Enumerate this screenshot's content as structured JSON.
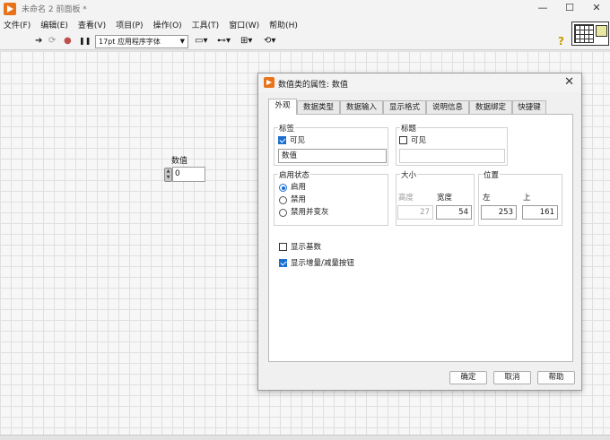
{
  "window": {
    "title": "未命名 2 前面板 *",
    "controls": [
      "—",
      "☐",
      "✕"
    ]
  },
  "menu": [
    "文件(F)",
    "编辑(E)",
    "查看(V)",
    "项目(P)",
    "操作(O)",
    "工具(T)",
    "窗口(W)",
    "帮助(H)"
  ],
  "toolbar": {
    "run": "➔",
    "run_continuous": "⟳",
    "abort": "●",
    "pause": "❚❚",
    "font": "17pt 应用程序字体",
    "align": "▭▾",
    "distribute": "⊷▾",
    "resize": "⊞▾",
    "reorder": "⟲▾",
    "help": "?"
  },
  "control": {
    "label": "数值",
    "value": "0"
  },
  "dialog": {
    "title": "数值类的属性: 数值",
    "close": "✕",
    "tabs": [
      "外观",
      "数据类型",
      "数据输入",
      "显示格式",
      "说明信息",
      "数据绑定",
      "快捷键"
    ],
    "active_tab": "外观",
    "label_group": {
      "title": "标签",
      "visible_label": "可见",
      "visible": true,
      "text": "数值"
    },
    "caption_group": {
      "title": "标题",
      "visible_label": "可见",
      "visible": false,
      "text": ""
    },
    "enable_group": {
      "title": "启用状态",
      "options": [
        "启用",
        "禁用",
        "禁用并变灰"
      ],
      "selected": "启用"
    },
    "size_group": {
      "title": "大小",
      "height_label": "高度",
      "height": "27",
      "width_label": "宽度",
      "width": "54"
    },
    "position_group": {
      "title": "位置",
      "left_label": "左",
      "left": "253",
      "top_label": "上",
      "top": "161"
    },
    "show_radix": {
      "label": "显示基数",
      "checked": false
    },
    "show_incdec": {
      "label": "显示增量/减量按钮",
      "checked": true
    },
    "buttons": {
      "ok": "确定",
      "cancel": "取消",
      "help": "帮助"
    }
  }
}
